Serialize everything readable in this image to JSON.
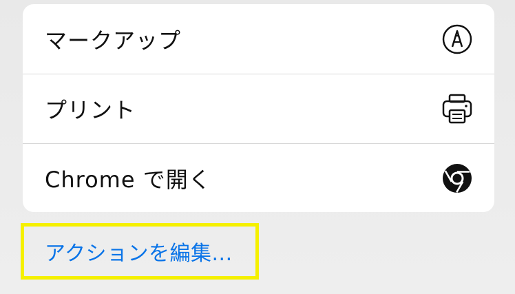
{
  "menu": {
    "items": [
      {
        "label": "マークアップ",
        "icon": "markup-pen-icon"
      },
      {
        "label": "プリント",
        "icon": "printer-icon"
      },
      {
        "label": "Chrome で開く",
        "icon": "chrome-icon"
      }
    ]
  },
  "edit_actions": {
    "label": "アクションを編集..."
  },
  "colors": {
    "accent": "#0a74e8",
    "highlight": "#f5f000",
    "card": "#ffffff",
    "background": "#ededed"
  }
}
